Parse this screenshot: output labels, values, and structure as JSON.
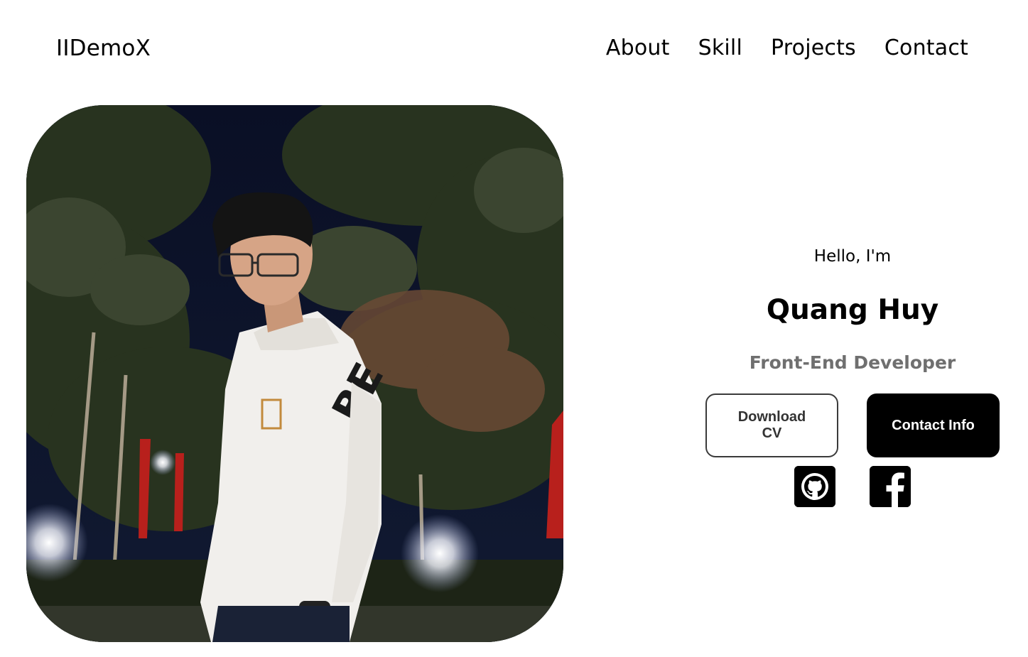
{
  "nav": {
    "logo": "IIDemoX",
    "links": [
      {
        "label": "About"
      },
      {
        "label": "Skill"
      },
      {
        "label": "Projects"
      },
      {
        "label": "Contact"
      }
    ]
  },
  "hero": {
    "greeting": "Hello, I'm",
    "name": "Quang Huy",
    "role": "Front-End Developer",
    "download_cv_label": "Download CV",
    "contact_info_label": "Contact Info",
    "photo_alt": "Profile picture",
    "socials": [
      {
        "icon": "github-icon"
      },
      {
        "icon": "facebook-icon"
      }
    ]
  },
  "colors": {
    "role_text": "#6f6f6f",
    "button_dark": "#000000",
    "background": "#ffffff"
  }
}
